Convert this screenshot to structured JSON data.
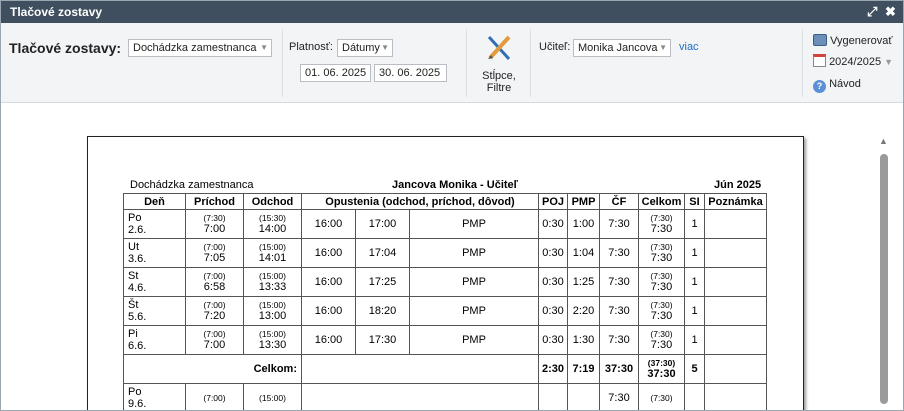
{
  "window": {
    "title": "Tlačové zostavy",
    "expand_icon": "expand-icon",
    "close_icon": "close-icon"
  },
  "toolbar": {
    "report_label": "Tlačové zostavy:",
    "report_select": "Dochádzka zamestnanca",
    "validity_label": "Platnosť:",
    "validity_select": "Dátumy",
    "date_from": "01. 06. 2025",
    "date_to": "30. 06. 2025",
    "columns_filter_label_1": "Stĺpce,",
    "columns_filter_label_2": "Filtre",
    "teacher_label": "Učiteľ:",
    "teacher_select": "Monika Jancova",
    "more_link": "viac",
    "generate_button": "Vygenerovať",
    "year_select": "2024/2025",
    "help_link": "Návod"
  },
  "report": {
    "left_title": "Dochádzka zamestnanca",
    "center_title": "Jancova Monika - Učiteľ",
    "right_title": "Jún 2025",
    "headers": [
      "Deň",
      "Príchod",
      "Odchod",
      "Opustenia (odchod, príchod, dôvod)",
      "POJ",
      "PMP",
      "ČF",
      "Celkom",
      "SI",
      "Poznámka"
    ],
    "rows": [
      {
        "day": "Po",
        "date": "2.6.",
        "arr_plan": "(7:30)",
        "arr": "7:00",
        "dep_plan": "(15:30)",
        "dep": "14:00",
        "l_out": "16:00",
        "l_in": "17:00",
        "reason": "PMP",
        "poj": "0:30",
        "pmp": "1:00",
        "cf": "7:30",
        "tot_plan": "(7:30)",
        "tot": "7:30",
        "si": "1",
        "note": ""
      },
      {
        "day": "Ut",
        "date": "3.6.",
        "arr_plan": "(7:00)",
        "arr": "7:05",
        "dep_plan": "(15:00)",
        "dep": "14:01",
        "l_out": "16:00",
        "l_in": "17:04",
        "reason": "PMP",
        "poj": "0:30",
        "pmp": "1:04",
        "cf": "7:30",
        "tot_plan": "(7:30)",
        "tot": "7:30",
        "si": "1",
        "note": ""
      },
      {
        "day": "St",
        "date": "4.6.",
        "arr_plan": "(7:00)",
        "arr": "6:58",
        "dep_plan": "(15:00)",
        "dep": "13:33",
        "l_out": "16:00",
        "l_in": "17:25",
        "reason": "PMP",
        "poj": "0:30",
        "pmp": "1:25",
        "cf": "7:30",
        "tot_plan": "(7:30)",
        "tot": "7:30",
        "si": "1",
        "note": ""
      },
      {
        "day": "Št",
        "date": "5.6.",
        "arr_plan": "(7:00)",
        "arr": "7:20",
        "dep_plan": "(15:00)",
        "dep": "13:00",
        "l_out": "16:00",
        "l_in": "18:20",
        "reason": "PMP",
        "poj": "0:30",
        "pmp": "2:20",
        "cf": "7:30",
        "tot_plan": "(7:30)",
        "tot": "7:30",
        "si": "1",
        "note": ""
      },
      {
        "day": "Pi",
        "date": "6.6.",
        "arr_plan": "(7:00)",
        "arr": "7:00",
        "dep_plan": "(15:00)",
        "dep": "13:30",
        "l_out": "16:00",
        "l_in": "17:30",
        "reason": "PMP",
        "poj": "0:30",
        "pmp": "1:30",
        "cf": "7:30",
        "tot_plan": "(7:30)",
        "tot": "7:30",
        "si": "1",
        "note": ""
      }
    ],
    "total": {
      "label": "Celkom:",
      "poj": "2:30",
      "pmp": "7:19",
      "cf": "37:30",
      "tot_plan": "(37:30)",
      "tot": "37:30",
      "si": "5"
    },
    "partial_row": {
      "day": "Po",
      "date": "9.6.",
      "arr_plan": "(7:00)",
      "dep_plan": "(15:00)",
      "cf": "7:30",
      "tot_plan": "(7:30)"
    }
  }
}
